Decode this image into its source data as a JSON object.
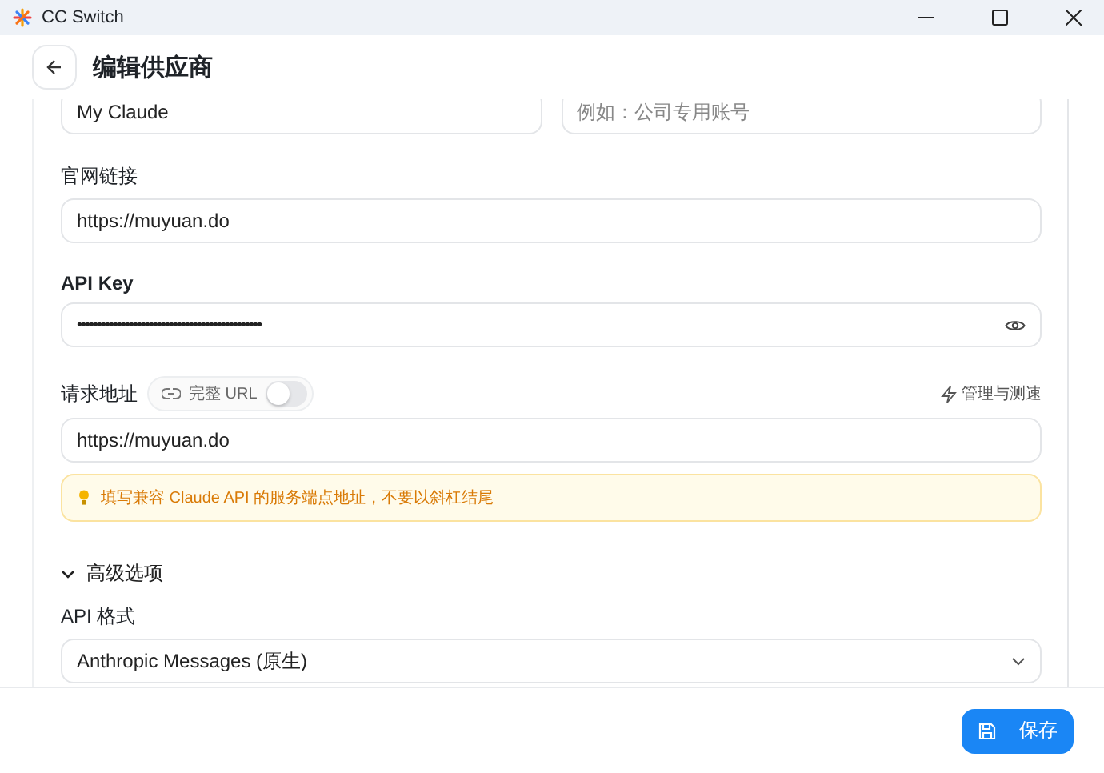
{
  "window": {
    "title": "CC Switch"
  },
  "header": {
    "title": "编辑供应商"
  },
  "top_fields": [
    {
      "value": "My Claude"
    },
    {
      "placeholder": "例如：公司专用账号"
    }
  ],
  "website": {
    "label": "官网链接",
    "value": "https://muyuan.do"
  },
  "api_key": {
    "label": "API Key",
    "value": "••••••••••••••••••••••••••••••••••••••••••••••"
  },
  "endpoint": {
    "label": "请求地址",
    "toggle": {
      "label": "完整 URL",
      "on": false
    },
    "manage_link": "管理与测速",
    "value": "https://muyuan.do",
    "hint": "填写兼容 Claude API 的服务端点地址，不要以斜杠结尾"
  },
  "advanced": {
    "label": "高级选项",
    "expanded": true,
    "api_format": {
      "label": "API 格式",
      "value": "Anthropic Messages (原生)"
    }
  },
  "footer": {
    "save_button": "保存"
  }
}
